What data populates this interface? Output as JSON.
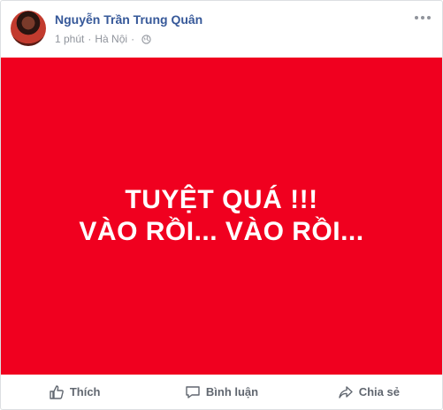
{
  "post": {
    "author_name": "Nguyễn Trần Trung Quân",
    "time": "1 phút",
    "separator": "·",
    "location": "Hà Nội",
    "privacy_icon": "globe-icon",
    "more_icon": "more-options-icon"
  },
  "banner": {
    "background": "#f0001f",
    "text_color": "#ffffff",
    "line1": "TUYỆT QUÁ !!!",
    "line2": "VÀO RỒI... VÀO RỒI..."
  },
  "actions": {
    "like_label": "Thích",
    "comment_label": "Bình luận",
    "share_label": "Chia sẻ"
  },
  "colors": {
    "name": "#365899",
    "meta": "#90949c",
    "action_text": "#616770"
  }
}
